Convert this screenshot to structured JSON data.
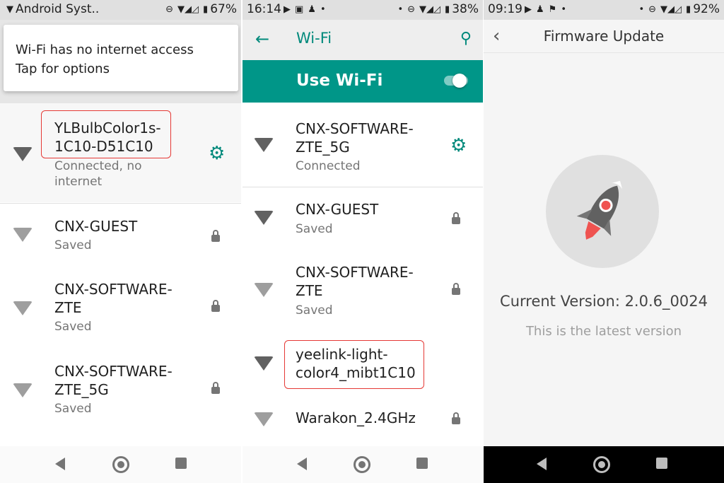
{
  "panel1": {
    "status": {
      "left": "Android Syst..",
      "right": "67%"
    },
    "notification": {
      "title": "Wi-Fi has no internet access",
      "subtitle": "Tap for options"
    },
    "networks": [
      {
        "ssid": "YLBulbColor1s-1C10-D51C10",
        "ssid_line1": "YLBulbColor1s-",
        "ssid_line2": "1C10-D51C10",
        "status_line1": "Connected, no",
        "status_line2": "internet"
      },
      {
        "ssid": "CNX-GUEST",
        "status": "Saved"
      },
      {
        "ssid_line1": "CNX-SOFTWARE-",
        "ssid_line2": "ZTE",
        "status": "Saved"
      },
      {
        "ssid_line1": "CNX-SOFTWARE-",
        "ssid_line2": "ZTE_5G",
        "status": "Saved"
      }
    ]
  },
  "panel2": {
    "status": {
      "time": "16:14",
      "right": "38%"
    },
    "appbar": {
      "title": "Wi-Fi"
    },
    "use_wifi": {
      "label": "Use Wi-Fi",
      "enabled": true
    },
    "networks": [
      {
        "ssid_line1": "CNX-SOFTWARE-",
        "ssid_line2": "ZTE_5G",
        "status": "Connected"
      },
      {
        "ssid": "CNX-GUEST",
        "status": "Saved"
      },
      {
        "ssid_line1": "CNX-SOFTWARE-",
        "ssid_line2": "ZTE",
        "status": "Saved"
      },
      {
        "ssid_line1": "yeelink-light-",
        "ssid_line2": "color4_mibt1C10"
      },
      {
        "ssid": "Warakon_2.4GHz"
      }
    ]
  },
  "panel3": {
    "status": {
      "time": "09:19",
      "right": "92%"
    },
    "header": {
      "title": "Firmware Update"
    },
    "current_version": "Current Version: 2.0.6_0024",
    "latest_note": "This is the latest version"
  },
  "colors": {
    "accent": "#009688",
    "highlight_box": "#e53935"
  },
  "icons": [
    "wifi-icon",
    "lock-icon",
    "gear-icon",
    "search-icon",
    "back-arrow-icon",
    "rocket-icon",
    "nav-back-icon",
    "nav-home-icon",
    "nav-recent-icon"
  ]
}
